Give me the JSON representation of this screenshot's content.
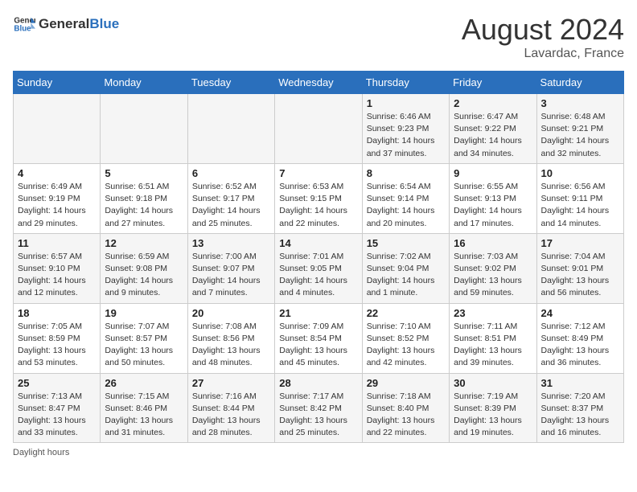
{
  "header": {
    "logo_general": "General",
    "logo_blue": "Blue",
    "month_year": "August 2024",
    "location": "Lavardac, France"
  },
  "days_of_week": [
    "Sunday",
    "Monday",
    "Tuesday",
    "Wednesday",
    "Thursday",
    "Friday",
    "Saturday"
  ],
  "weeks": [
    [
      {
        "day": "",
        "info": ""
      },
      {
        "day": "",
        "info": ""
      },
      {
        "day": "",
        "info": ""
      },
      {
        "day": "",
        "info": ""
      },
      {
        "day": "1",
        "info": "Sunrise: 6:46 AM\nSunset: 9:23 PM\nDaylight: 14 hours\nand 37 minutes."
      },
      {
        "day": "2",
        "info": "Sunrise: 6:47 AM\nSunset: 9:22 PM\nDaylight: 14 hours\nand 34 minutes."
      },
      {
        "day": "3",
        "info": "Sunrise: 6:48 AM\nSunset: 9:21 PM\nDaylight: 14 hours\nand 32 minutes."
      }
    ],
    [
      {
        "day": "4",
        "info": "Sunrise: 6:49 AM\nSunset: 9:19 PM\nDaylight: 14 hours\nand 29 minutes."
      },
      {
        "day": "5",
        "info": "Sunrise: 6:51 AM\nSunset: 9:18 PM\nDaylight: 14 hours\nand 27 minutes."
      },
      {
        "day": "6",
        "info": "Sunrise: 6:52 AM\nSunset: 9:17 PM\nDaylight: 14 hours\nand 25 minutes."
      },
      {
        "day": "7",
        "info": "Sunrise: 6:53 AM\nSunset: 9:15 PM\nDaylight: 14 hours\nand 22 minutes."
      },
      {
        "day": "8",
        "info": "Sunrise: 6:54 AM\nSunset: 9:14 PM\nDaylight: 14 hours\nand 20 minutes."
      },
      {
        "day": "9",
        "info": "Sunrise: 6:55 AM\nSunset: 9:13 PM\nDaylight: 14 hours\nand 17 minutes."
      },
      {
        "day": "10",
        "info": "Sunrise: 6:56 AM\nSunset: 9:11 PM\nDaylight: 14 hours\nand 14 minutes."
      }
    ],
    [
      {
        "day": "11",
        "info": "Sunrise: 6:57 AM\nSunset: 9:10 PM\nDaylight: 14 hours\nand 12 minutes."
      },
      {
        "day": "12",
        "info": "Sunrise: 6:59 AM\nSunset: 9:08 PM\nDaylight: 14 hours\nand 9 minutes."
      },
      {
        "day": "13",
        "info": "Sunrise: 7:00 AM\nSunset: 9:07 PM\nDaylight: 14 hours\nand 7 minutes."
      },
      {
        "day": "14",
        "info": "Sunrise: 7:01 AM\nSunset: 9:05 PM\nDaylight: 14 hours\nand 4 minutes."
      },
      {
        "day": "15",
        "info": "Sunrise: 7:02 AM\nSunset: 9:04 PM\nDaylight: 14 hours\nand 1 minute."
      },
      {
        "day": "16",
        "info": "Sunrise: 7:03 AM\nSunset: 9:02 PM\nDaylight: 13 hours\nand 59 minutes."
      },
      {
        "day": "17",
        "info": "Sunrise: 7:04 AM\nSunset: 9:01 PM\nDaylight: 13 hours\nand 56 minutes."
      }
    ],
    [
      {
        "day": "18",
        "info": "Sunrise: 7:05 AM\nSunset: 8:59 PM\nDaylight: 13 hours\nand 53 minutes."
      },
      {
        "day": "19",
        "info": "Sunrise: 7:07 AM\nSunset: 8:57 PM\nDaylight: 13 hours\nand 50 minutes."
      },
      {
        "day": "20",
        "info": "Sunrise: 7:08 AM\nSunset: 8:56 PM\nDaylight: 13 hours\nand 48 minutes."
      },
      {
        "day": "21",
        "info": "Sunrise: 7:09 AM\nSunset: 8:54 PM\nDaylight: 13 hours\nand 45 minutes."
      },
      {
        "day": "22",
        "info": "Sunrise: 7:10 AM\nSunset: 8:52 PM\nDaylight: 13 hours\nand 42 minutes."
      },
      {
        "day": "23",
        "info": "Sunrise: 7:11 AM\nSunset: 8:51 PM\nDaylight: 13 hours\nand 39 minutes."
      },
      {
        "day": "24",
        "info": "Sunrise: 7:12 AM\nSunset: 8:49 PM\nDaylight: 13 hours\nand 36 minutes."
      }
    ],
    [
      {
        "day": "25",
        "info": "Sunrise: 7:13 AM\nSunset: 8:47 PM\nDaylight: 13 hours\nand 33 minutes."
      },
      {
        "day": "26",
        "info": "Sunrise: 7:15 AM\nSunset: 8:46 PM\nDaylight: 13 hours\nand 31 minutes."
      },
      {
        "day": "27",
        "info": "Sunrise: 7:16 AM\nSunset: 8:44 PM\nDaylight: 13 hours\nand 28 minutes."
      },
      {
        "day": "28",
        "info": "Sunrise: 7:17 AM\nSunset: 8:42 PM\nDaylight: 13 hours\nand 25 minutes."
      },
      {
        "day": "29",
        "info": "Sunrise: 7:18 AM\nSunset: 8:40 PM\nDaylight: 13 hours\nand 22 minutes."
      },
      {
        "day": "30",
        "info": "Sunrise: 7:19 AM\nSunset: 8:39 PM\nDaylight: 13 hours\nand 19 minutes."
      },
      {
        "day": "31",
        "info": "Sunrise: 7:20 AM\nSunset: 8:37 PM\nDaylight: 13 hours\nand 16 minutes."
      }
    ]
  ],
  "footer": {
    "daylight_label": "Daylight hours"
  }
}
